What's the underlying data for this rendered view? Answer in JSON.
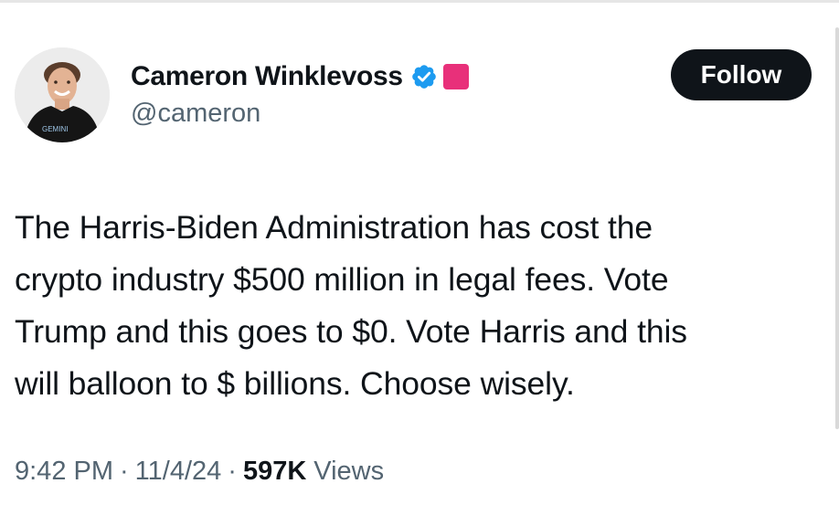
{
  "author": {
    "display_name": "Cameron Winklevoss",
    "handle": "@cameron",
    "avatar_shirt_text": "GEMINI",
    "verified_color": "#1d9bf0",
    "badge_color": "#e8307a"
  },
  "follow_button": {
    "label": "Follow",
    "background": "#0f1419",
    "text_color": "#ffffff"
  },
  "tweet": {
    "lines": [
      "The Harris-Biden Administration has cost the",
      "crypto industry $500 million in legal fees. Vote",
      "Trump and this goes to $0. Vote Harris and this",
      "will balloon to $ billions. Choose wisely."
    ]
  },
  "meta": {
    "time": "9:42 PM",
    "separator": "·",
    "date": "11/4/24",
    "views_count": "597K",
    "views_label": "Views"
  }
}
